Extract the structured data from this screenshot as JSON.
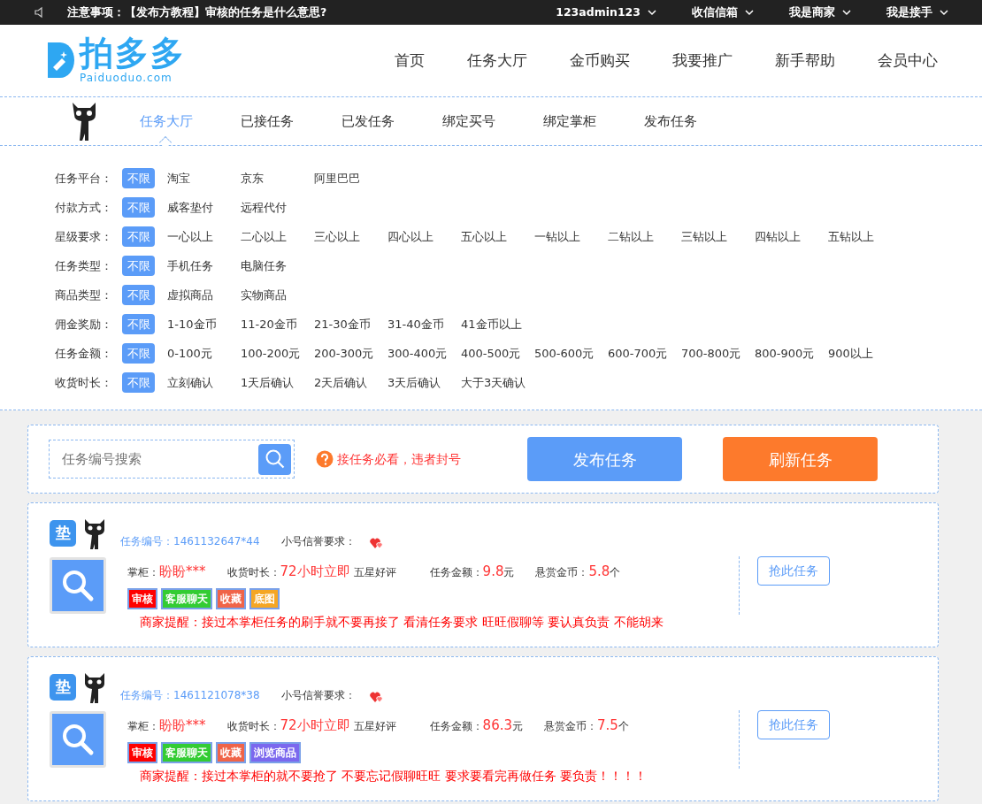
{
  "topbar": {
    "notice_label": "注意事项：",
    "notice_text": "【发布方教程】审核的任务是什么意思?",
    "menus": [
      "123admin123",
      "收信信箱",
      "我是商家",
      "我是接手"
    ]
  },
  "logo": {
    "name": "拍多多",
    "domain": "Paiduoduo.com"
  },
  "main_nav": [
    "首页",
    "任务大厅",
    "金币购买",
    "我要推广",
    "新手帮助",
    "会员中心"
  ],
  "sub_nav": [
    {
      "label": "任务大厅",
      "selected": true
    },
    {
      "label": "已接任务",
      "selected": false
    },
    {
      "label": "已发任务",
      "selected": false
    },
    {
      "label": "绑定买号",
      "selected": false
    },
    {
      "label": "绑定掌柜",
      "selected": false
    },
    {
      "label": "发布任务",
      "selected": false
    }
  ],
  "filters": [
    {
      "label": "任务平台：",
      "options": [
        {
          "text": "不限",
          "selected": true
        },
        {
          "text": "淘宝",
          "selected": false
        },
        {
          "text": "京东",
          "selected": false
        },
        {
          "text": "阿里巴巴",
          "selected": false
        }
      ]
    },
    {
      "label": "付款方式：",
      "options": [
        {
          "text": "不限",
          "selected": true
        },
        {
          "text": "威客垫付",
          "selected": false
        },
        {
          "text": "远程代付",
          "selected": false
        }
      ]
    },
    {
      "label": "星级要求：",
      "options": [
        {
          "text": "不限",
          "selected": true
        },
        {
          "text": "一心以上",
          "selected": false
        },
        {
          "text": "二心以上",
          "selected": false
        },
        {
          "text": "三心以上",
          "selected": false
        },
        {
          "text": "四心以上",
          "selected": false
        },
        {
          "text": "五心以上",
          "selected": false
        },
        {
          "text": "一钻以上",
          "selected": false
        },
        {
          "text": "二钻以上",
          "selected": false
        },
        {
          "text": "三钻以上",
          "selected": false
        },
        {
          "text": "四钻以上",
          "selected": false
        },
        {
          "text": "五钻以上",
          "selected": false
        }
      ]
    },
    {
      "label": "任务类型：",
      "options": [
        {
          "text": "不限",
          "selected": true
        },
        {
          "text": "手机任务",
          "selected": false
        },
        {
          "text": "电脑任务",
          "selected": false
        }
      ]
    },
    {
      "label": "商品类型：",
      "options": [
        {
          "text": "不限",
          "selected": true
        },
        {
          "text": "虚拟商品",
          "selected": false
        },
        {
          "text": "实物商品",
          "selected": false
        }
      ]
    },
    {
      "label": "佣金奖励：",
      "options": [
        {
          "text": "不限",
          "selected": true
        },
        {
          "text": "1-10金币",
          "selected": false
        },
        {
          "text": "11-20金币",
          "selected": false
        },
        {
          "text": "21-30金币",
          "selected": false
        },
        {
          "text": "31-40金币",
          "selected": false
        },
        {
          "text": "41金币以上",
          "selected": false
        }
      ]
    },
    {
      "label": "任务金额：",
      "options": [
        {
          "text": "不限",
          "selected": true
        },
        {
          "text": "0-100元",
          "selected": false
        },
        {
          "text": "100-200元",
          "selected": false
        },
        {
          "text": "200-300元",
          "selected": false
        },
        {
          "text": "300-400元",
          "selected": false
        },
        {
          "text": "400-500元",
          "selected": false
        },
        {
          "text": "500-600元",
          "selected": false
        },
        {
          "text": "600-700元",
          "selected": false
        },
        {
          "text": "700-800元",
          "selected": false
        },
        {
          "text": "800-900元",
          "selected": false
        },
        {
          "text": "900以上",
          "selected": false
        }
      ]
    },
    {
      "label": "收货时长：",
      "options": [
        {
          "text": "不限",
          "selected": true
        },
        {
          "text": "立刻确认",
          "selected": false
        },
        {
          "text": "1天后确认",
          "selected": false
        },
        {
          "text": "2天后确认",
          "selected": false
        },
        {
          "text": "3天后确认",
          "selected": false
        },
        {
          "text": "大于3天确认",
          "selected": false
        }
      ]
    }
  ],
  "toolbar": {
    "search": {
      "placeholder": "任务编号搜索"
    },
    "warning": "接任务必看，违者封号",
    "buttons": [
      "发布任务",
      "刷新任务"
    ]
  },
  "tasks": [
    {
      "badge": "垫",
      "id_label": "任务编号：",
      "id": "1461132647*44",
      "credit_label": "小号信誉要求：",
      "shop_label": "掌柜：",
      "shop": "盼盼***",
      "time_label": "收货时长：",
      "time": "72小时立即",
      "review": "五星好评",
      "amount_label": "任务金额：",
      "amount": "9.8",
      "amount_unit": "元",
      "reward_label": "悬赏金币：",
      "reward": "5.8",
      "reward_unit": "个",
      "tags": [
        {
          "text": "审核",
          "color": "#ff0000"
        },
        {
          "text": "客服聊天",
          "color": "#33cc33"
        },
        {
          "text": "收藏",
          "color": "#f06448"
        },
        {
          "text": "底图",
          "color": "#f5a623"
        }
      ],
      "reminder": "商家提醒：接过本掌柜任务的刷手就不要再接了 看清任务要求 旺旺假聊等 要认真负责 不能胡来",
      "action": "抢此任务"
    },
    {
      "badge": "垫",
      "id_label": "任务编号：",
      "id": "1461121078*38",
      "credit_label": "小号信誉要求：",
      "shop_label": "掌柜：",
      "shop": "盼盼***",
      "time_label": "收货时长：",
      "time": "72小时立即",
      "review": "五星好评",
      "amount_label": "任务金额：",
      "amount": "86.3",
      "amount_unit": "元",
      "reward_label": "悬赏金币：",
      "reward": "7.5",
      "reward_unit": "个",
      "tags": [
        {
          "text": "审核",
          "color": "#ff0000"
        },
        {
          "text": "客服聊天",
          "color": "#33cc33"
        },
        {
          "text": "收藏",
          "color": "#f06448"
        },
        {
          "text": "浏览商品",
          "color": "#7b68ee"
        }
      ],
      "reminder": "商家提醒：接过本掌柜的就不要抢了 不要忘记假聊旺旺 要求要看完再做任务 要负责！！！！",
      "action": "抢此任务"
    }
  ]
}
